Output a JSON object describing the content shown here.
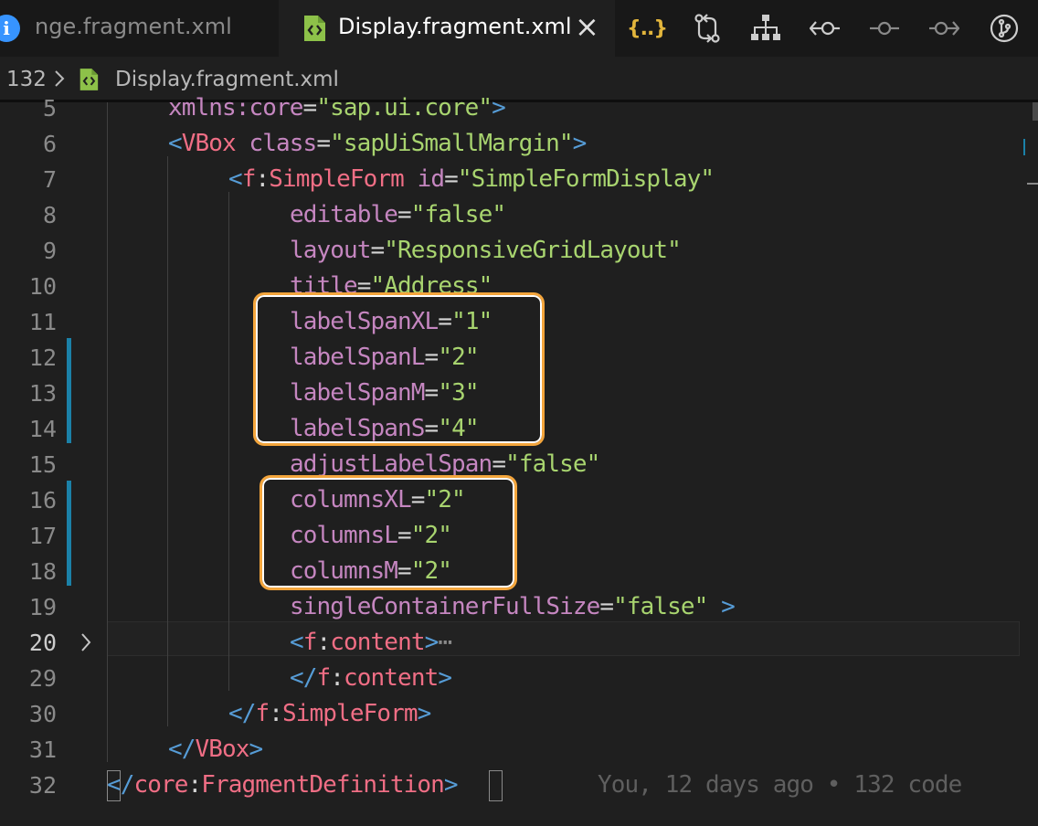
{
  "tabs": [
    {
      "label": "nge.fragment.xml",
      "active": false
    },
    {
      "label": "Display.fragment.xml",
      "active": true
    }
  ],
  "toolbar": {
    "icons": [
      "braces-icon",
      "compare-changes-icon",
      "hierarchy-icon",
      "go-back-icon",
      "timeline-icon",
      "go-forward-icon",
      "git-graph-icon"
    ]
  },
  "breadcrumb": {
    "project": "132",
    "file": "Display.fragment.xml"
  },
  "lines": [
    {
      "n": "5"
    },
    {
      "n": "6"
    },
    {
      "n": "7"
    },
    {
      "n": "8"
    },
    {
      "n": "9"
    },
    {
      "n": "10"
    },
    {
      "n": "11"
    },
    {
      "n": "12"
    },
    {
      "n": "13"
    },
    {
      "n": "14"
    },
    {
      "n": "15"
    },
    {
      "n": "16"
    },
    {
      "n": "17"
    },
    {
      "n": "18"
    },
    {
      "n": "19"
    },
    {
      "n": "20"
    },
    {
      "n": "29"
    },
    {
      "n": "30"
    },
    {
      "n": "31"
    },
    {
      "n": "32"
    }
  ],
  "code": {
    "l5": {
      "attr": "xmlns:core",
      "eq": "=",
      "val": "\"sap.ui.core\"",
      "end": ">"
    },
    "l6": {
      "open": "<",
      "tag": "VBox",
      "attr": " class",
      "eq": "=",
      "val": "\"sapUiSmallMargin\"",
      "end": ">"
    },
    "l7": {
      "open": "<",
      "ns": "f",
      "colon": ":",
      "tag": "SimpleForm",
      "attr": " id",
      "eq": "=",
      "val": "\"SimpleFormDisplay\""
    },
    "l8": {
      "attr": "editable",
      "eq": "=",
      "val": "\"false\""
    },
    "l9": {
      "attr": "layout",
      "eq": "=",
      "val": "\"ResponsiveGridLayout\""
    },
    "l10": {
      "attr": "title",
      "eq": "=",
      "val": "\"Address\""
    },
    "l11": {
      "attr": "labelSpanXL",
      "eq": "=",
      "val": "\"1\""
    },
    "l12": {
      "attr": "labelSpanL",
      "eq": "=",
      "val": "\"2\""
    },
    "l13": {
      "attr": "labelSpanM",
      "eq": "=",
      "val": "\"3\""
    },
    "l14": {
      "attr": "labelSpanS",
      "eq": "=",
      "val": "\"4\""
    },
    "l15": {
      "attr": "adjustLabelSpan",
      "eq": "=",
      "val": "\"false\""
    },
    "l16": {
      "attr": "columnsXL",
      "eq": "=",
      "val": "\"2\""
    },
    "l17": {
      "attr": "columnsL",
      "eq": "=",
      "val": "\"2\""
    },
    "l18": {
      "attr": "columnsM",
      "eq": "=",
      "val": "\"2\""
    },
    "l19": {
      "attr": "singleContainerFullSize",
      "eq": "=",
      "val": "\"false\"",
      "end": " >"
    },
    "l20": {
      "open": "<",
      "ns": "f",
      "colon": ":",
      "tag": "content",
      "end": ">",
      "ellipsis": "⋯"
    },
    "l29": {
      "open": "</",
      "ns": "f",
      "colon": ":",
      "tag": "content",
      "end": ">"
    },
    "l30": {
      "open": "</",
      "ns": "f",
      "colon": ":",
      "tag": "SimpleForm",
      "end": ">"
    },
    "l31": {
      "open": "</",
      "tag": "VBox",
      "end": ">"
    },
    "l32": {
      "open": "</",
      "ns": "core",
      "colon": ":",
      "tag": "FragmentDefinition",
      "end": ">"
    }
  },
  "blame": "You, 12 days ago • 132 code",
  "colors": {
    "highlight_box": "#f3a53c",
    "modified_gutter": "#1b81a8",
    "braces_icon": "#e2b53c",
    "xml_file_icon": "#8dc149"
  }
}
